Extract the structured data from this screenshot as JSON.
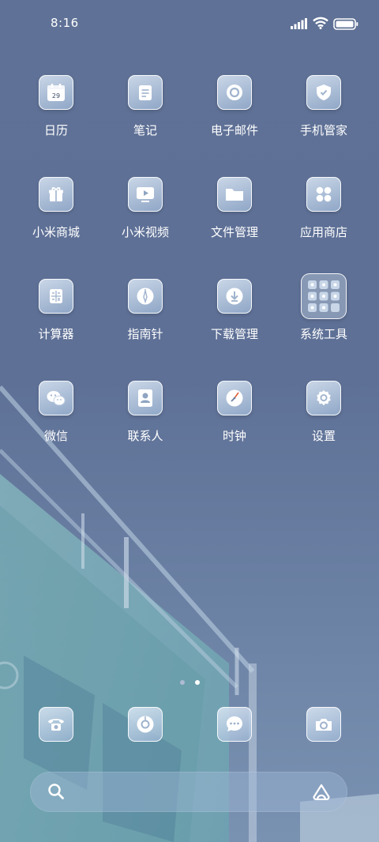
{
  "status_bar": {
    "time": "8:16",
    "icons": [
      "signal-icon",
      "wifi-icon",
      "battery-icon"
    ]
  },
  "apps": [
    {
      "label": "日历",
      "icon": "calendar-icon",
      "badge": "29"
    },
    {
      "label": "笔记",
      "icon": "notes-icon"
    },
    {
      "label": "电子邮件",
      "icon": "email-icon"
    },
    {
      "label": "手机管家",
      "icon": "security-shield-icon"
    },
    {
      "label": "小米商城",
      "icon": "mall-gift-icon"
    },
    {
      "label": "小米视频",
      "icon": "video-play-icon"
    },
    {
      "label": "文件管理",
      "icon": "folder-icon"
    },
    {
      "label": "应用商店",
      "icon": "app-store-icon"
    },
    {
      "label": "计算器",
      "icon": "calculator-icon"
    },
    {
      "label": "指南针",
      "icon": "compass-icon"
    },
    {
      "label": "下载管理",
      "icon": "download-icon"
    },
    {
      "label": "系统工具",
      "icon": "folder-system-tools-icon"
    },
    {
      "label": "微信",
      "icon": "wechat-icon"
    },
    {
      "label": "联系人",
      "icon": "contacts-icon"
    },
    {
      "label": "时钟",
      "icon": "clock-icon"
    },
    {
      "label": "设置",
      "icon": "settings-gear-icon"
    }
  ],
  "page_indicator": {
    "count": 2,
    "active": 2
  },
  "dock": [
    "phone-icon",
    "browser-icon",
    "messages-icon",
    "camera-icon"
  ],
  "search_bar": {
    "icons": [
      "search-icon",
      "assistant-icon"
    ]
  },
  "colors": {
    "background": "#5f7196",
    "text": "#ffffff",
    "dot_active": "#ffffff",
    "dot_inactive": "#aebbd2"
  }
}
